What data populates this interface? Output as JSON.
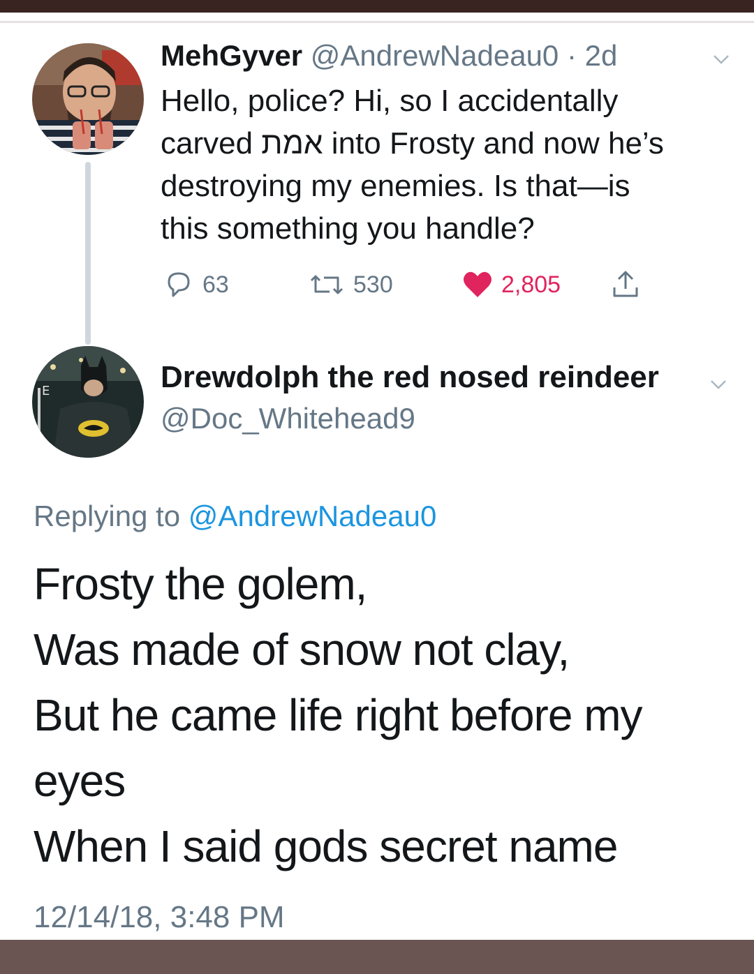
{
  "tweet1": {
    "display_name": "MehGyver",
    "handle": "@AndrewNadeau0",
    "time": "· 2d",
    "lines": [
      "Hello, police? Hi, so I accidentally",
      "carved אמת into Frosty and now he’s",
      "destroying my enemies. Is that—is",
      "this something you handle?"
    ],
    "replies": "63",
    "retweets": "530",
    "likes": "2,805",
    "liked": true,
    "like_color": "#e0245e"
  },
  "tweet2": {
    "display_name": "Drewdolph the red nosed reindeer",
    "handle": "@Doc_Whitehead9",
    "replying_prefix": "Replying to",
    "replying_to": "@AndrewNadeau0",
    "lines": [
      "Frosty the golem,",
      "Was made of snow not clay,",
      "But he came life right before my",
      "eyes",
      "When I said gods secret name"
    ],
    "timestamp": "12/14/18, 3:48 PM"
  },
  "icons": {
    "reply": "reply-icon",
    "retweet": "retweet-icon",
    "like": "heart-icon",
    "share": "share-icon",
    "caret": "chevron-down-icon"
  },
  "colors": {
    "link": "#1b95e0",
    "muted": "#657786",
    "text": "#14171a"
  }
}
